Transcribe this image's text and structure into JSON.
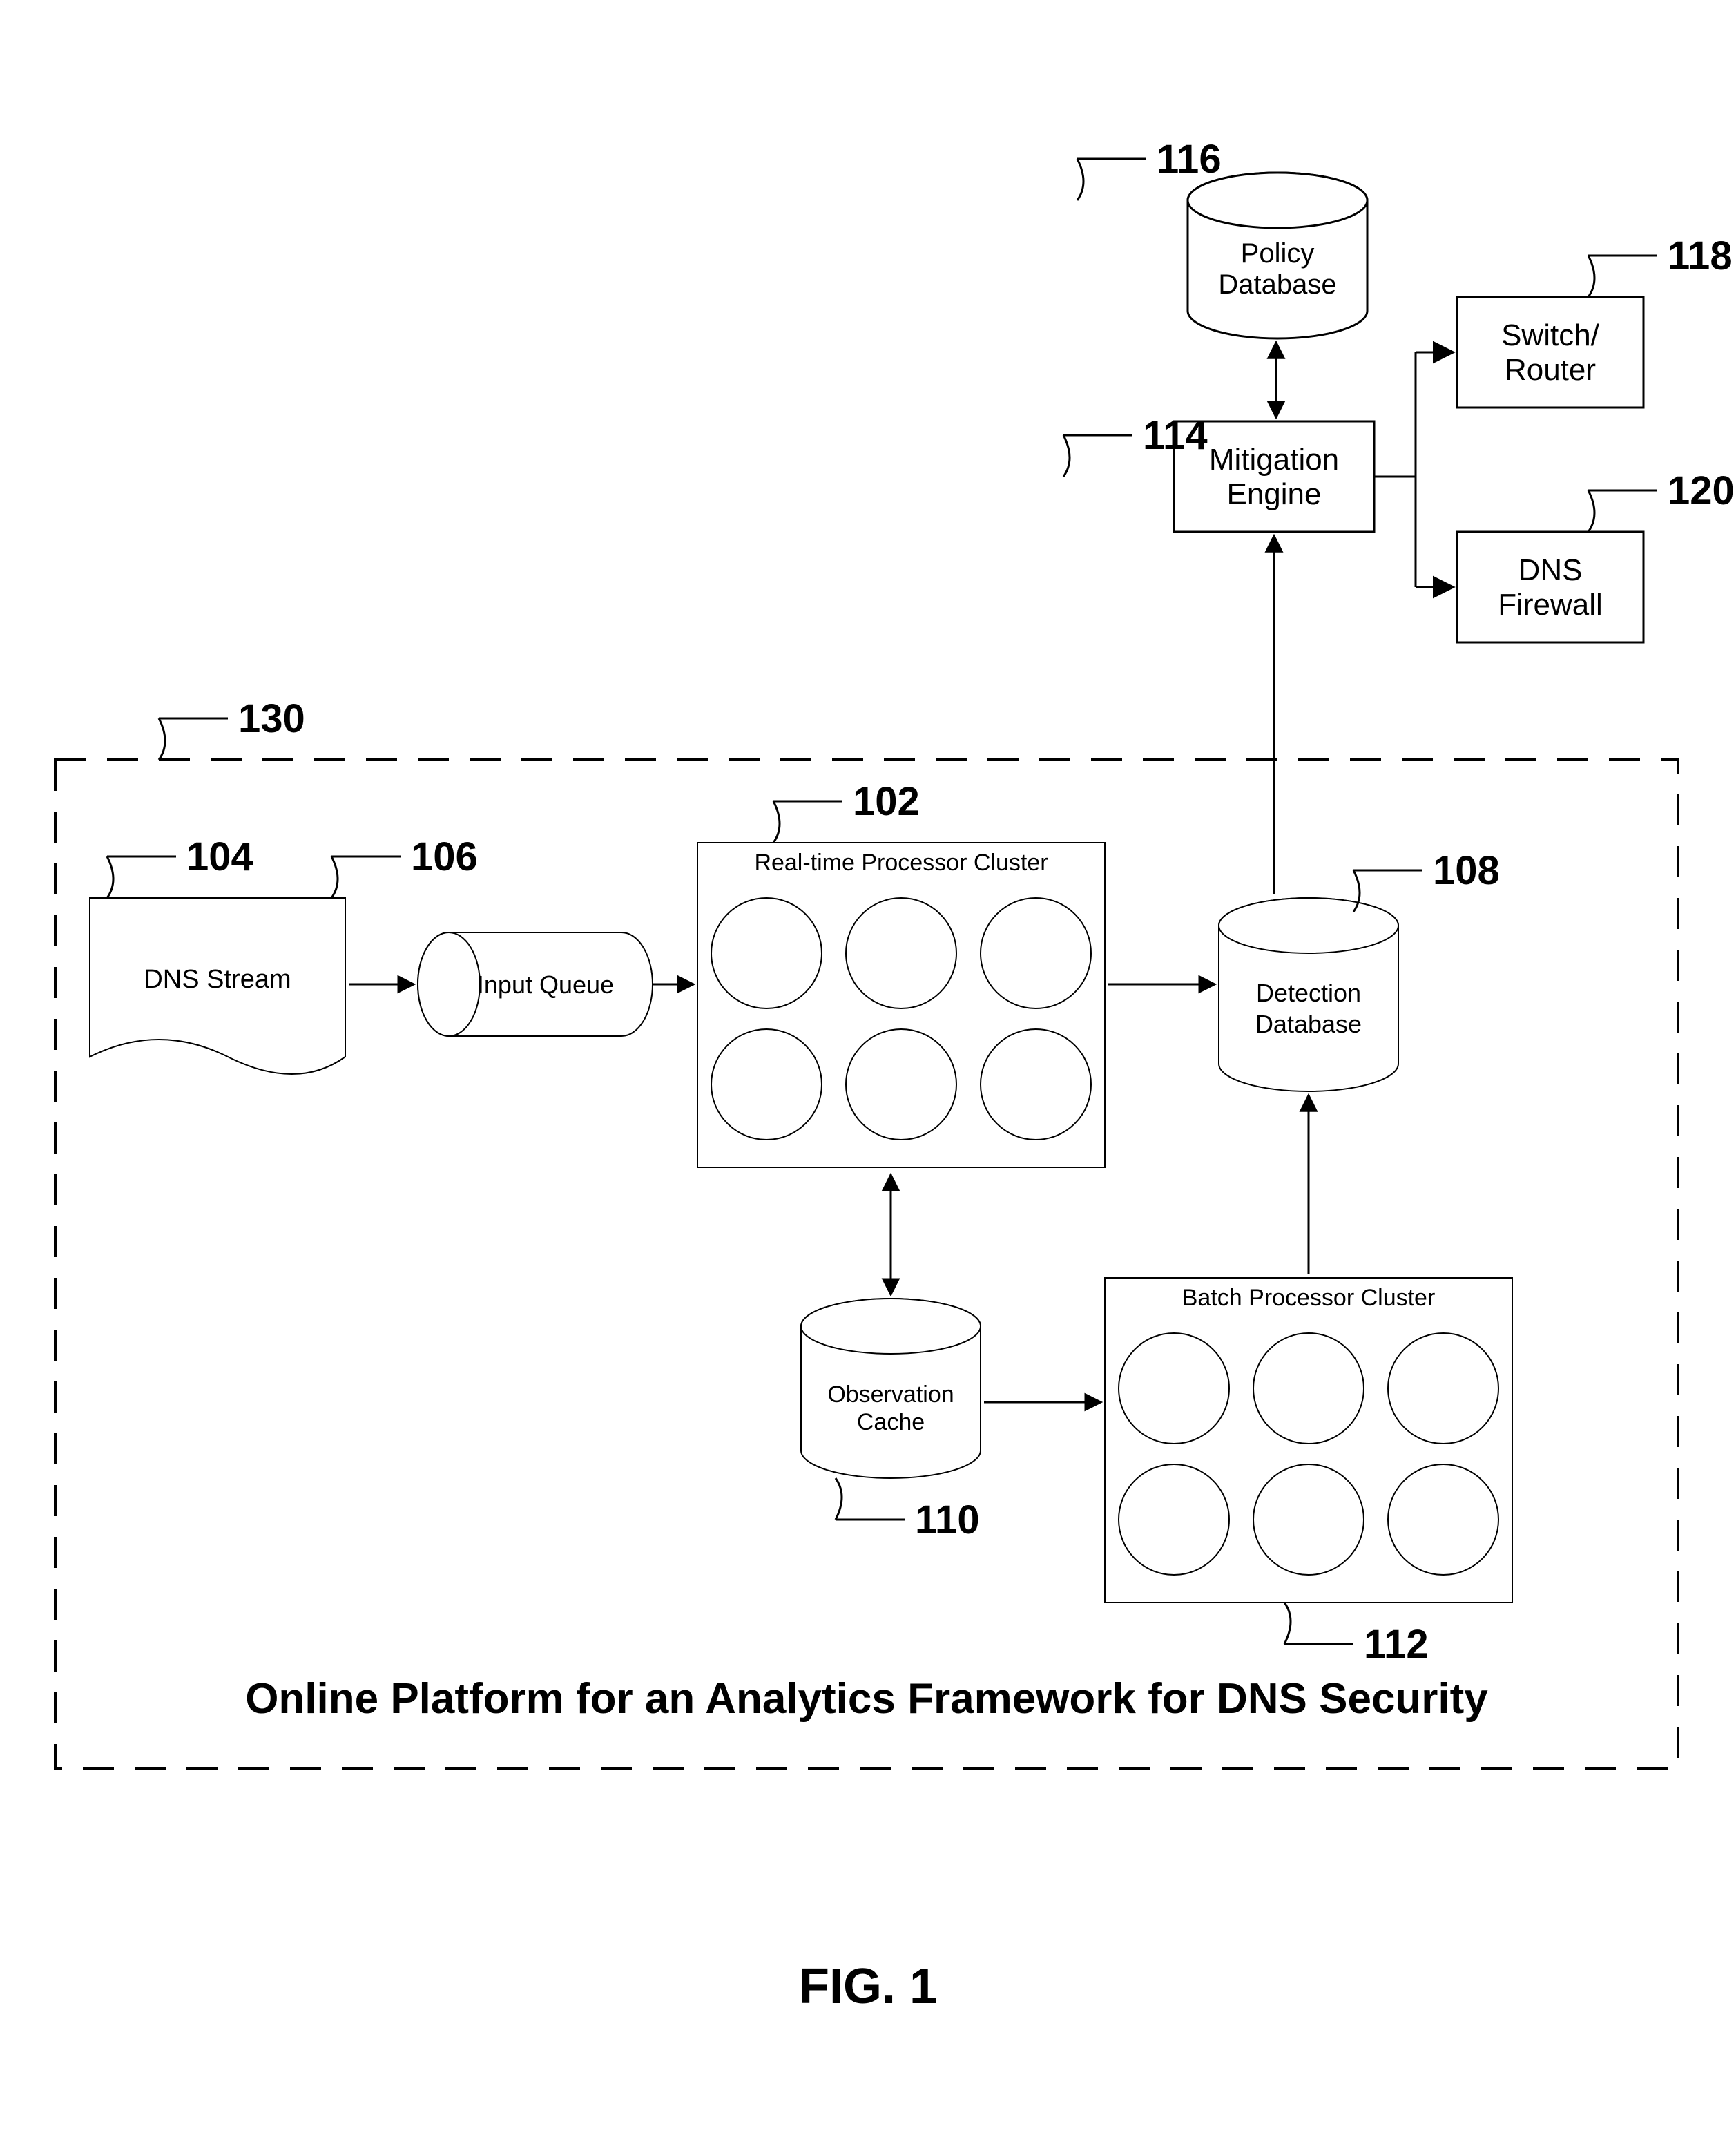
{
  "refs": {
    "n102": "102",
    "n104": "104",
    "n106": "106",
    "n108": "108",
    "n110": "110",
    "n112": "112",
    "n114": "114",
    "n116": "116",
    "n118": "118",
    "n120": "120",
    "n130": "130"
  },
  "labels": {
    "dns_stream": "DNS Stream",
    "input_queue": "Input Queue",
    "rt_cluster": "Real-time Processor Cluster",
    "obs_cache_l1": "Observation",
    "obs_cache_l2": "Cache",
    "batch_cluster": "Batch Processor Cluster",
    "det_db_l1": "Detection",
    "det_db_l2": "Database",
    "mitigation_l1": "Mitigation",
    "mitigation_l2": "Engine",
    "policy_db_l1": "Policy",
    "policy_db_l2": "Database",
    "switch_l1": "Switch/",
    "switch_l2": "Router",
    "dns_fw_l1": "DNS",
    "dns_fw_l2": "Firewall",
    "platform_title": "Online Platform for an Analytics Framework for DNS Security"
  },
  "figure": "FIG. 1"
}
